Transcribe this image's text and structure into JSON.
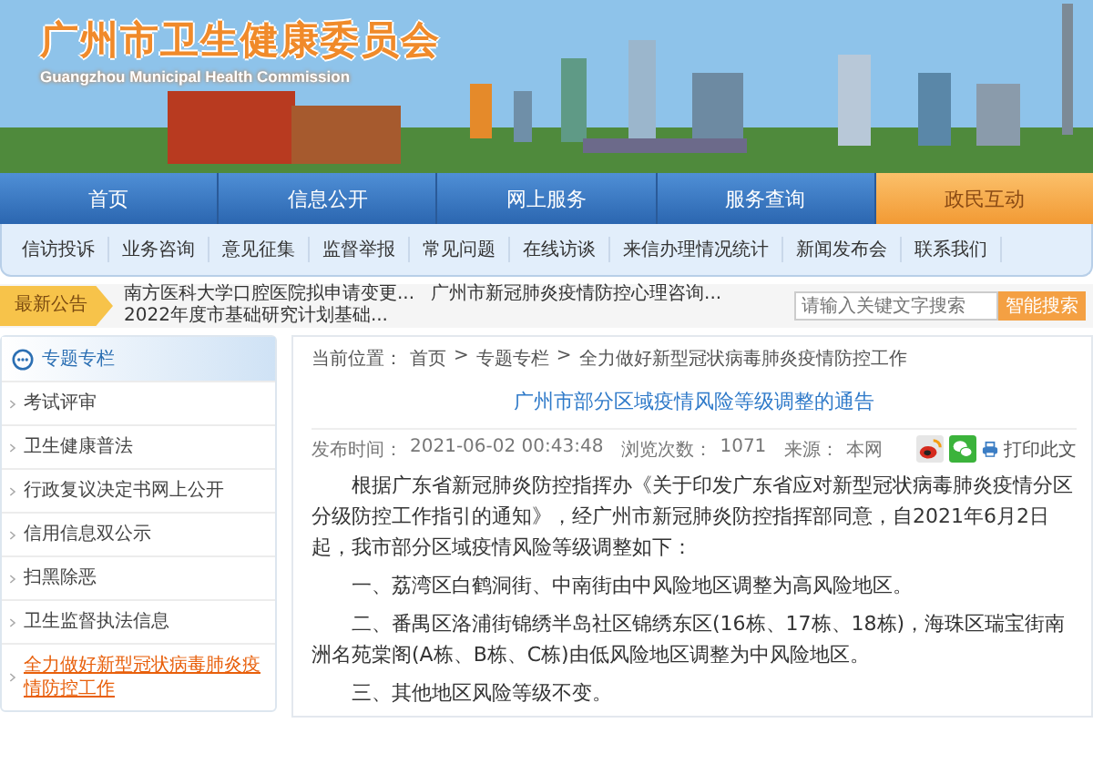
{
  "header": {
    "title": "广州市卫生健康委员会",
    "subtitle": "Guangzhou Municipal Health Commission"
  },
  "nav": [
    {
      "label": "首页",
      "selected": false
    },
    {
      "label": "信息公开",
      "selected": false
    },
    {
      "label": "网上服务",
      "selected": false
    },
    {
      "label": "服务查询",
      "selected": false
    },
    {
      "label": "政民互动",
      "selected": true
    }
  ],
  "subnav": [
    "信访投诉",
    "业务咨询",
    "意见征集",
    "监督举报",
    "常见问题",
    "在线访谈",
    "来信办理情况统计",
    "新闻发布会",
    "联系我们"
  ],
  "notice": {
    "label": "最新公告",
    "items": [
      "南方医科大学口腔医院拟申请变更...",
      "广州市新冠肺炎疫情防控心理咨询...",
      "2022年度市基础研究计划基础..."
    ]
  },
  "search": {
    "placeholder": "请输入关键文字搜索",
    "button": "智能搜索"
  },
  "sidebar": {
    "title": "专题专栏",
    "items": [
      {
        "label": "考试评审",
        "selected": false
      },
      {
        "label": "卫生健康普法",
        "selected": false
      },
      {
        "label": "行政复议决定书网上公开",
        "selected": false
      },
      {
        "label": "信用信息双公示",
        "selected": false
      },
      {
        "label": "扫黑除恶",
        "selected": false
      },
      {
        "label": "卫生监督执法信息",
        "selected": false
      },
      {
        "label": "全力做好新型冠状病毒肺炎疫情防控工作",
        "selected": true
      }
    ]
  },
  "article": {
    "breadcrumb_label": "当前位置：",
    "breadcrumb": [
      "首页",
      "专题专栏",
      "全力做好新型冠状病毒肺炎疫情防控工作"
    ],
    "breadcrumb_separator": ">",
    "title": "广州市部分区域疫情风险等级调整的通告",
    "meta": [
      {
        "label": "发布时间：",
        "value": "2021-06-02 00:43:48"
      },
      {
        "label": "浏览次数：",
        "value": "1071"
      },
      {
        "label": "来源：",
        "value": "本网"
      }
    ],
    "print": "打印此文",
    "paragraphs": [
      "根据广东省新冠肺炎防控指挥办《关于印发广东省应对新型冠状病毒肺炎疫情分区分级防控工作指引的通知》，经广州市新冠肺炎防控指挥部同意，自2021年6月2日起，我市部分区域疫情风险等级调整如下：",
      "一、荔湾区白鹤洞街、中南街由中风险地区调整为高风险地区。",
      "二、番禺区洛浦街锦绣半岛社区锦绣东区(16栋、17栋、18栋)，海珠区瑞宝街南洲名苑棠阁(A栋、B栋、C栋)由低风险地区调整为中风险地区。",
      "三、其他地区风险等级不变。"
    ]
  }
}
